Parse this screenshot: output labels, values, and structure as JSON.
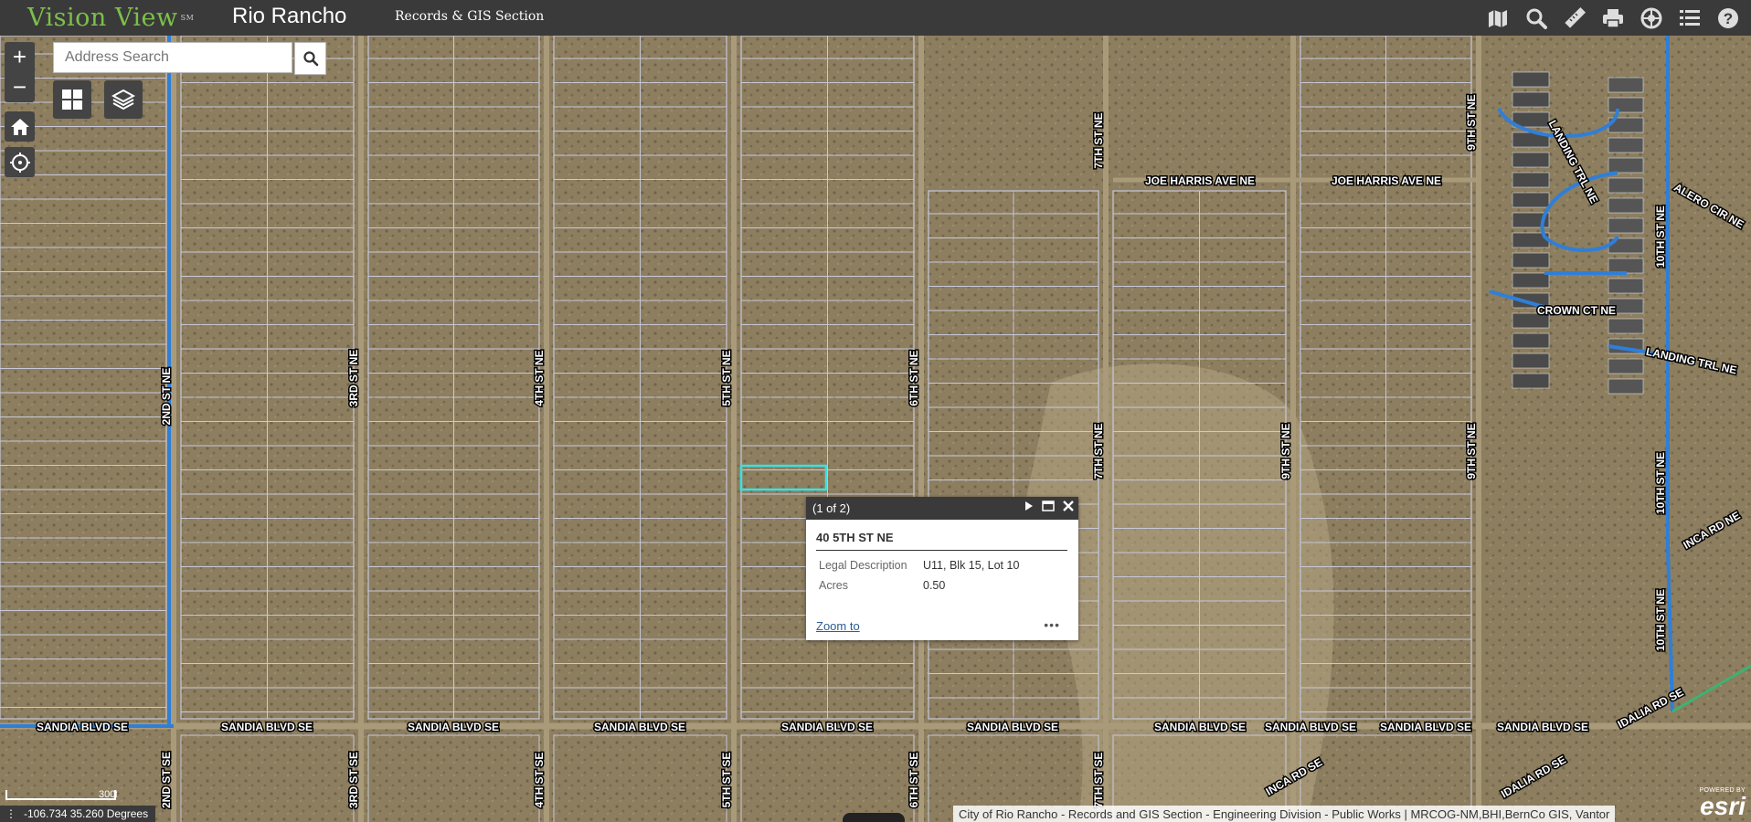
{
  "header": {
    "logo_text": "Vision View",
    "logo_sup": "SM",
    "city": "Rio Rancho",
    "section": "Records & GIS Section",
    "tools": [
      {
        "icon": "map-book-icon"
      },
      {
        "icon": "search-icon"
      },
      {
        "icon": "measure-icon"
      },
      {
        "icon": "print-icon"
      },
      {
        "icon": "basemap-icon"
      },
      {
        "icon": "layer-list-icon"
      },
      {
        "icon": "help-icon"
      }
    ]
  },
  "map_controls": {
    "zoom_in": "+",
    "zoom_out": "−",
    "search_placeholder": "Address Search"
  },
  "street_labels": {
    "vertical": [
      "2ND ST NE",
      "3RD ST NE",
      "4TH ST NE",
      "5TH ST NE",
      "6TH ST NE",
      "7TH ST NE",
      "7TH ST NE",
      "9TH ST NE",
      "9TH ST NE",
      "9TH ST NE",
      "10TH ST NE",
      "10TH ST NE",
      "10TH ST NE",
      "2ND ST SE",
      "3RD ST SE",
      "4TH ST SE",
      "5TH ST SE",
      "6TH ST SE",
      "7TH ST SE"
    ],
    "sandia": "SANDIA BLVD SE",
    "joe_harris": "JOE HARRIS AVE NE",
    "landing_trl": "LANDING TRL NE",
    "crown_ct": "CROWN CT NE",
    "alero_cir": "ALERO CIR NE",
    "inca_rd_ne": "INCA RD NE",
    "inca_rd_se": "INCA RD SE",
    "idalia_rd_se": "IDALIA RD SE"
  },
  "popup": {
    "counter": "(1 of 2)",
    "title": "40 5TH ST NE",
    "fields": [
      {
        "label": "Legal Description",
        "value": "U11, Blk 15, Lot 10"
      },
      {
        "label": "Acres",
        "value": "0.50"
      }
    ],
    "zoom_link": "Zoom to",
    "more": "•••"
  },
  "footer": {
    "coordinates": "-106.734 35.260 Degrees",
    "scale_label": "300ft",
    "attribution": "City of Rio Rancho - Records and GIS Section - Engineering Division - Public Works | MRCOG-NM,BHI,BernCo GIS, Vantor",
    "powered_by": "POWERED BY",
    "esri": "esri"
  },
  "colors": {
    "header_bg": "#3a3a3a",
    "logo_green": "#7cc04a",
    "selected_parcel": "#3de0e0",
    "water_line": "#2f7fd8",
    "parcel_line": "#c8c8d8"
  }
}
